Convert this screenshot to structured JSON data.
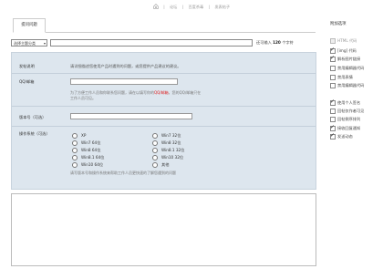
{
  "breadcrumb": {
    "sep": "|",
    "items": [
      "论坛",
      "百度杀毒",
      "发表帖子"
    ]
  },
  "tab": {
    "label": "提问问题"
  },
  "subject": {
    "type_select": "选择主题分类",
    "remaining_prefix": "还可输入",
    "remaining_count": "120",
    "remaining_suffix": "个字符"
  },
  "form": {
    "desc_label": "发帖说明",
    "desc_text": "请详细描述您使用产品时遇到的问题，或您提供产品建议的建议。",
    "qq_label": "QQ/邮箱",
    "qq_note_1": "为了方便工作人员和你联系您问题，请在以填写你的",
    "qq_note_red": "QQ/邮箱",
    "qq_note_2": "，您的QQ/邮箱只在",
    "qq_note_3": "工作人员可见。",
    "version_label": "版本号（可选）",
    "os_label": "操作系统（可选）",
    "os_options": [
      "XP",
      "Win7 32位",
      "Win7 64位",
      "Win8 32位",
      "Win8 64位",
      "Win8.1 32位",
      "Win8.1 64位",
      "Win10 32位",
      "Win10 64位",
      "其他"
    ],
    "version_note": "请写版本号和操作系统来帮助工作人员更快速的了解您遇到的问题"
  },
  "sidebar": {
    "title": "附加选项",
    "items": [
      {
        "label": "HTML 代码",
        "checked": false,
        "disabled": true
      },
      {
        "label": "[img] 代码",
        "checked": true,
        "disabled": false
      },
      {
        "label": "解析图片链接",
        "checked": true,
        "disabled": false
      },
      {
        "label": "禁用编辑器代码",
        "checked": false,
        "disabled": false
      },
      {
        "label": "禁用表情",
        "checked": false,
        "disabled": false
      },
      {
        "label": "禁用编辑器代码",
        "checked": false,
        "disabled": false
      },
      {
        "label": "使用个人签名",
        "checked": true,
        "disabled": false
      },
      {
        "label": "回帖仅作者可见",
        "checked": false,
        "disabled": false
      },
      {
        "label": "回帖倒序排列",
        "checked": false,
        "disabled": false
      },
      {
        "label": "接收回复通知",
        "checked": true,
        "disabled": false
      },
      {
        "label": "发送动态",
        "checked": true,
        "disabled": false
      }
    ]
  }
}
